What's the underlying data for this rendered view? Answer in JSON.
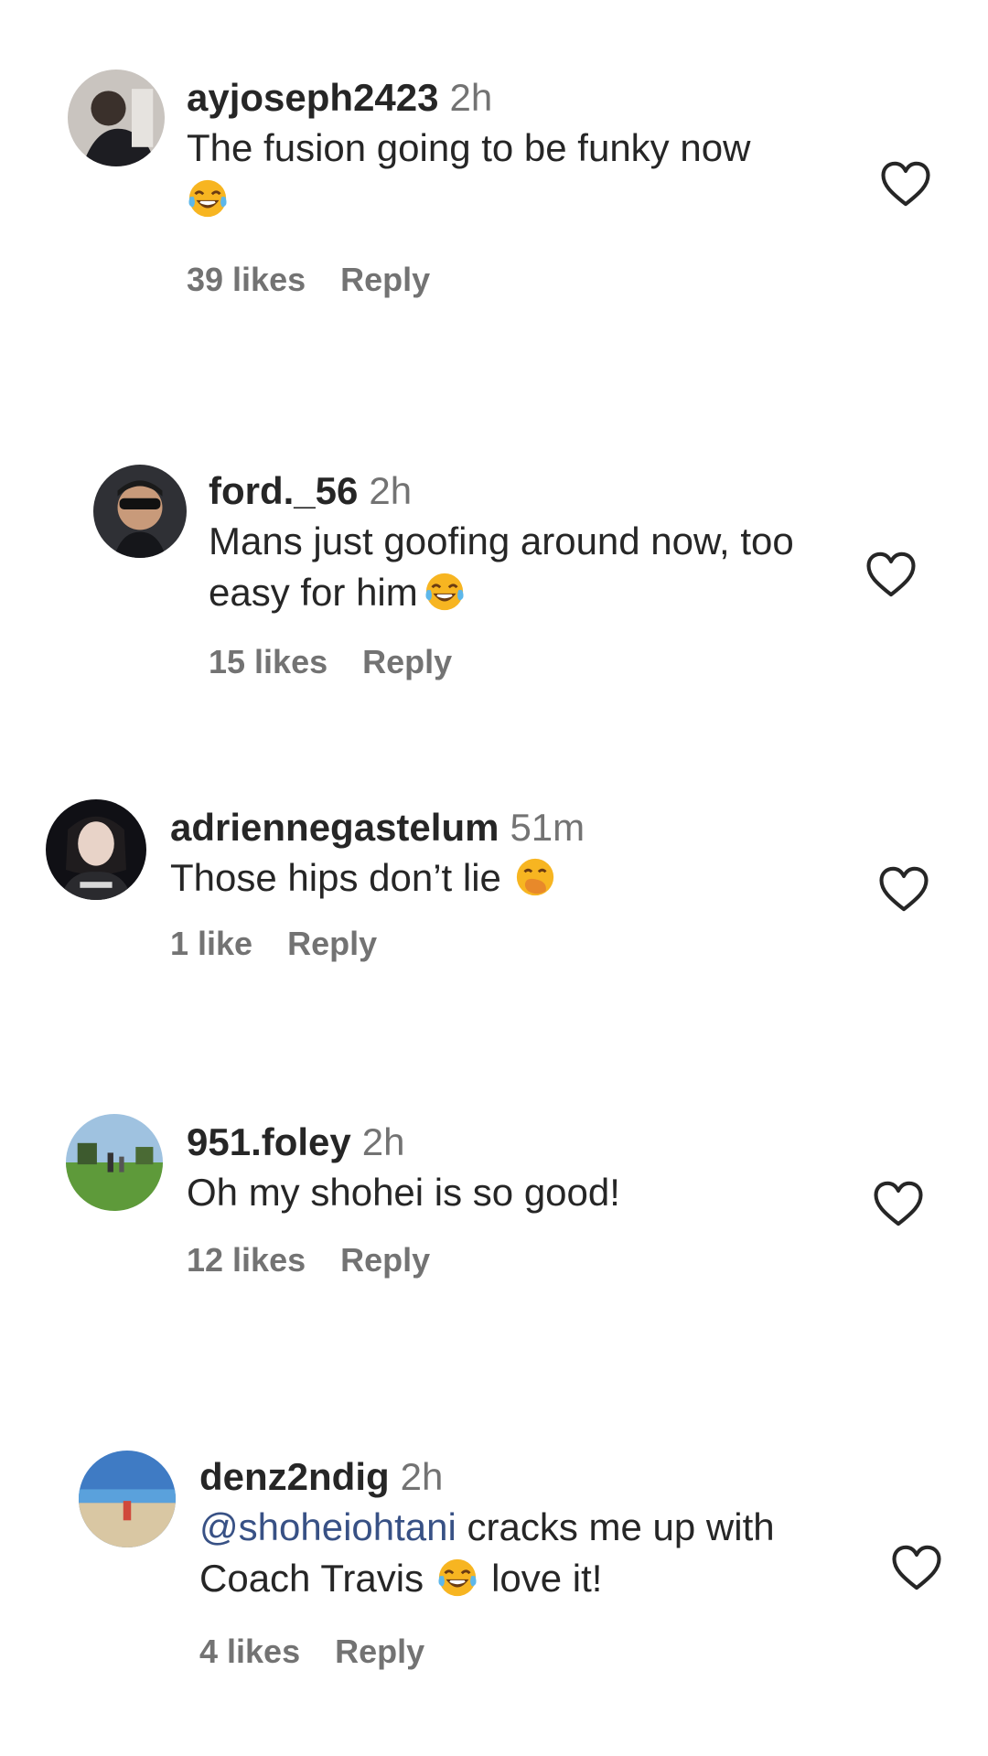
{
  "comments": [
    {
      "username": "ayjoseph2423",
      "time": "2h",
      "text": "The fusion going to be funky now",
      "likes": "39 likes",
      "reply": "Reply",
      "emoji": "tears-of-joy-emoji"
    },
    {
      "username": "ford._56",
      "time": "2h",
      "text": "Mans just goofing around now, too easy for him",
      "likes": "15 likes",
      "reply": "Reply",
      "emoji": "tears-of-joy-emoji"
    },
    {
      "username": "adriennegastelum",
      "time": "51m",
      "text": "Those hips don’t lie",
      "likes": "1 like",
      "reply": "Reply",
      "emoji": "face-with-hand-over-mouth-emoji"
    },
    {
      "username": "951.foley",
      "time": "2h",
      "text": "Oh my shohei is so good!",
      "likes": "12 likes",
      "reply": "Reply"
    },
    {
      "username": "denz2ndig",
      "time": "2h",
      "mention": "@shoheiohtani",
      "text_before_emoji": "cracks me up with Coach Travis",
      "text_after_emoji": "love it!",
      "likes": "4 likes",
      "reply": "Reply",
      "emoji": "tears-of-joy-emoji"
    }
  ],
  "colors": {
    "text": "#262626",
    "secondary": "#737373",
    "mention": "#385185"
  },
  "icons": {
    "like": "heart-outline-icon"
  }
}
